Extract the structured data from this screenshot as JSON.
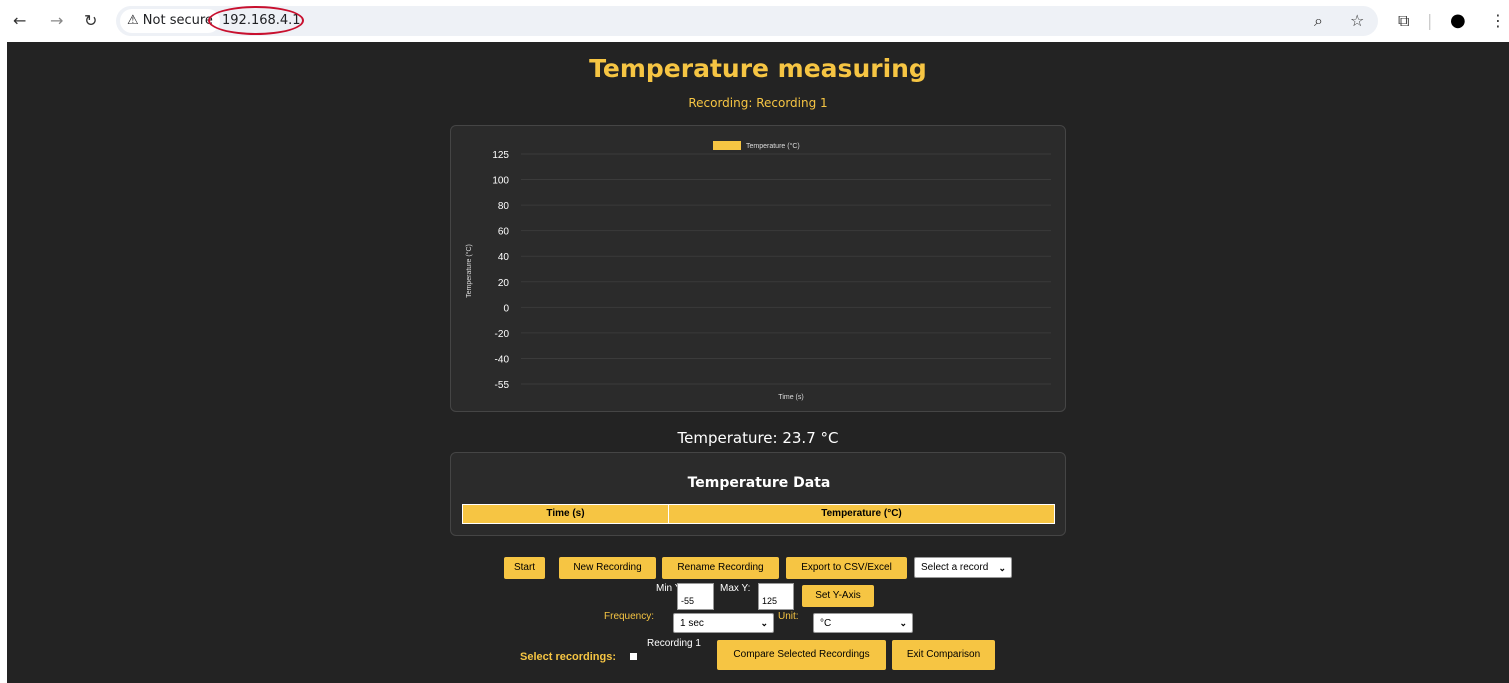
{
  "browser": {
    "back_icon": "←",
    "forward_icon": "→",
    "reload_icon": "↻",
    "security_label": "⚠ Not secure",
    "url": "192.168.4.1",
    "zoom_icon": "⌕",
    "star_icon": "☆",
    "extensions_icon": "⧉",
    "profile_icon": "●",
    "menu_icon": "⋮"
  },
  "page": {
    "title": "Temperature measuring",
    "recording_label": "Recording: Recording 1",
    "temperature_readout": "Temperature: 23.7 °C"
  },
  "chart_data": {
    "type": "line",
    "legend": "Temperature (°C)",
    "ylabel": "Temperature (°C)",
    "xlabel": "Time (s)",
    "ylim": [
      -55,
      125
    ],
    "yticks": [
      "125",
      "100",
      "80",
      "60",
      "40",
      "20",
      "0",
      "-20",
      "-40",
      "-55"
    ],
    "x": [],
    "series": [
      {
        "name": "Temperature (°C)",
        "values": []
      }
    ],
    "series_color": "#f6c543",
    "grid": true,
    "legend_position": "top-center"
  },
  "table": {
    "title": "Temperature Data",
    "columns": [
      "Time (s)",
      "Temperature (°C)"
    ],
    "rows": []
  },
  "controls": {
    "start_label": "Start",
    "new_recording_label": "New Recording",
    "rename_recording_label": "Rename Recording",
    "export_label": "Export to CSV/Excel",
    "record_select_value": "Select a record",
    "min_y_label": "Min Y:",
    "min_y_value": "-55",
    "max_y_label": "Max Y:",
    "max_y_value": "125",
    "set_y_axis_label": "Set Y-Axis",
    "frequency_label": "Frequency:",
    "frequency_value": "1 sec",
    "unit_label": "Unit:",
    "unit_value": "°C",
    "select_recordings_label": "Select recordings:",
    "recording_option_label": "Recording 1",
    "compare_label": "Compare Selected Recordings",
    "exit_comparison_label": "Exit Comparison",
    "chevron_icon": "⌄"
  },
  "colors": {
    "accent": "#f6c543",
    "page_background": "#232323",
    "panel_background": "#2b2b2b",
    "url_highlight": "#c8102e"
  }
}
